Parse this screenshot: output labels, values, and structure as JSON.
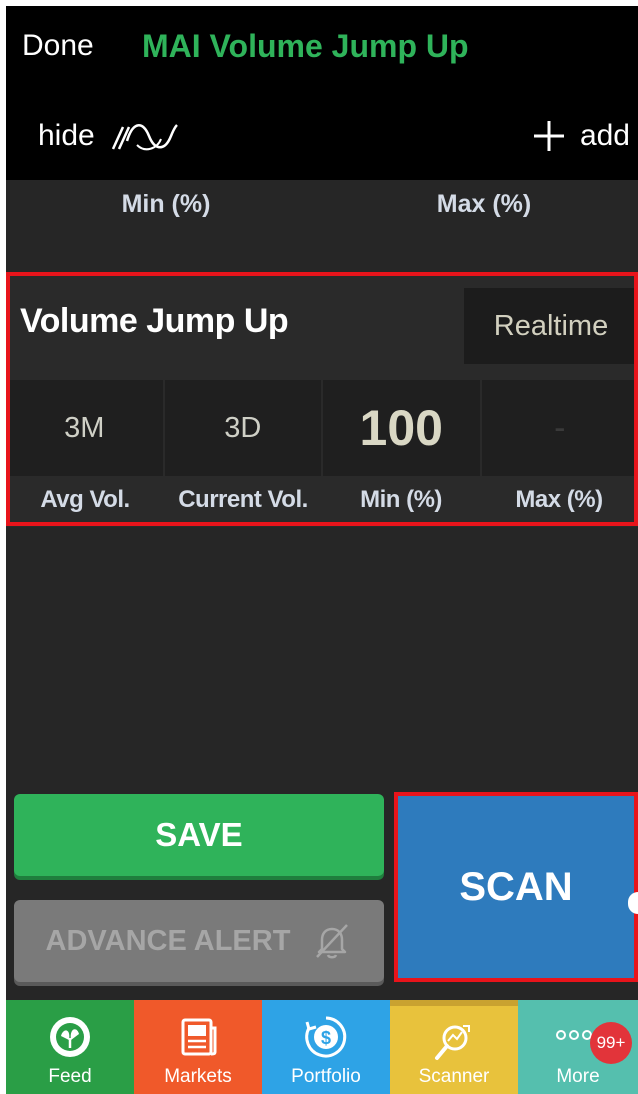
{
  "header": {
    "done_label": "Done",
    "title": "MAI Volume Jump Up",
    "hide_label": "hide",
    "add_label": "add"
  },
  "previous_row": {
    "min_label": "Min (%)",
    "max_label": "Max (%)"
  },
  "criteria": {
    "title": "Volume Jump Up",
    "mode": "Realtime",
    "cells": [
      {
        "value": "3M",
        "label": "Avg Vol."
      },
      {
        "value": "3D",
        "label": "Current Vol."
      },
      {
        "value": "100",
        "label": "Min (%)"
      },
      {
        "value": "-",
        "label": "Max (%)"
      }
    ]
  },
  "actions": {
    "save_label": "SAVE",
    "advance_alert_label": "ADVANCE ALERT",
    "scan_label": "SCAN"
  },
  "tabs": [
    {
      "label": "Feed",
      "icon": "leaf-icon"
    },
    {
      "label": "Markets",
      "icon": "newspaper-icon"
    },
    {
      "label": "Portfolio",
      "icon": "dollar-coin-icon"
    },
    {
      "label": "Scanner",
      "icon": "magnifier-icon"
    },
    {
      "label": "More",
      "icon": "dots-icon",
      "badge": "99+"
    }
  ],
  "colors": {
    "accent_green": "#2fb35a",
    "scan_blue": "#2e7bbd",
    "highlight_red": "#e8141b"
  }
}
